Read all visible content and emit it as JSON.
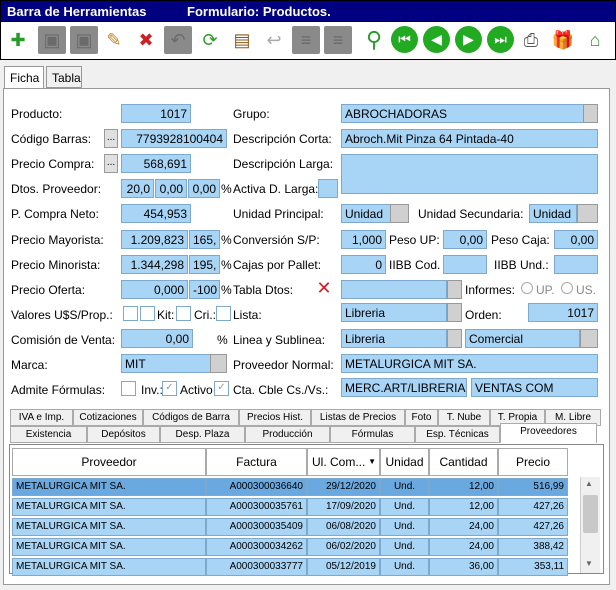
{
  "window": {
    "app": "Barra de Herramientas",
    "form": "Formulario: Productos."
  },
  "toolbar": {
    "icons": [
      "add-icon",
      "save-icon",
      "save-as-icon",
      "edit-icon",
      "delete-save-icon",
      "undo-icon",
      "refresh-icon",
      "film-icon",
      "back-arrow-icon",
      "list-icon",
      "list2-icon",
      "search-icon",
      "first-record-icon",
      "prev-record-icon",
      "next-record-icon",
      "last-record-icon",
      "print-icon",
      "gift-icon",
      "home-icon"
    ]
  },
  "tabs": [
    {
      "label": "Ficha"
    },
    {
      "label": "Tabla"
    }
  ],
  "form": {
    "producto_label": "Producto:",
    "producto": "1017",
    "grupo_label": "Grupo:",
    "grupo": "ABROCHADORAS",
    "codigo_barras_label": "Código Barras:",
    "codigo_barras": "7793928100404",
    "desc_corta_label": "Descripción Corta:",
    "desc_corta": "Abroch.Mit Pinza 64 Pintada-40",
    "precio_compra_label": "Precio Compra:",
    "precio_compra": "568,691",
    "desc_larga_label": "Descripción Larga:",
    "dtos_label": "Dtos. Proveedor:",
    "dto1": "20,0",
    "dto2": "0,00",
    "dto3": "0,00",
    "pct": "%",
    "activa_label": "Activa D. Larga:",
    "pcompra_neto_label": "P. Compra Neto:",
    "pcompra_neto": "454,953",
    "unidad_principal_label": "Unidad Principal:",
    "unidad_principal": "Unidad",
    "unidad_secundaria_label": "Unidad Secundaria:",
    "unidad_secundaria": "Unidad",
    "precio_mayorista_label": "Precio Mayorista:",
    "precio_mayorista": "1.209,823",
    "pct_mayorista": "165,",
    "conversion_label": "Conversión S/P:",
    "conversion": "1,000",
    "peso_up_label": "Peso UP:",
    "peso_up": "0,00",
    "peso_caja_label": "Peso Caja:",
    "peso_caja": "0,00",
    "precio_minorista_label": "Precio Minorista:",
    "precio_minorista": "1.344,298",
    "pct_minorista": "195,",
    "cajas_label": "Cajas por Pallet:",
    "cajas": "0",
    "iibb_cod_label": "IIBB Cod.",
    "iibb_und_label": "IIBB Und.:",
    "precio_oferta_label": "Precio Oferta:",
    "precio_oferta": "0,000",
    "pct_oferta": "-100",
    "tabla_dtos_label": "Tabla Dtos:",
    "informes_label": "Informes:",
    "informes_up": "UP.",
    "informes_us": "US.",
    "valores_label": "Valores U$S/Prop.:",
    "kit_label": "Kit:",
    "cri_label": "Cri.:",
    "lista_label": "Lista:",
    "lista": "Libreria",
    "orden_label": "Orden:",
    "orden": "1017",
    "comision_label": "Comisión de Venta:",
    "comision": "0,00",
    "linea_label": "Linea y Sublinea:",
    "linea": "Libreria",
    "sublinea": "Comercial",
    "marca_label": "Marca:",
    "marca": "MIT",
    "proveedor_label": "Proveedor Normal:",
    "proveedor": "METALURGICA MIT SA.",
    "admite_label": "Admite Fórmulas:",
    "inv_label": "Inv.:",
    "activo_label": "Activo",
    "cta_label": "Cta. Cble Cs./Vs.:",
    "cta1": "MERC.ART/LIBRERIA",
    "cta2": "VENTAS COM"
  },
  "bottom_tabs_row1": [
    "IVA e Imp.",
    "Cotizaciones",
    "Códigos de Barra",
    "Precios Hist.",
    "Listas de Precios",
    "Foto",
    "T. Nube",
    "T. Propia",
    "M. Libre"
  ],
  "bottom_tabs_row2": [
    "Existencia",
    "Depósitos",
    "Desp. Plaza",
    "Producción",
    "Fórmulas",
    "Esp. Técnicas",
    "Proveedores"
  ],
  "grid": {
    "headers": [
      "Proveedor",
      "Factura",
      "Ul. Com...",
      "Unidad",
      "Cantidad",
      "Precio"
    ],
    "rows": [
      [
        "METALURGICA MIT SA.",
        "A000300036640",
        "29/12/2020",
        "Und.",
        "12,00",
        "516,99"
      ],
      [
        "METALURGICA MIT SA.",
        "A000300035761",
        "17/09/2020",
        "Und.",
        "12,00",
        "427,26"
      ],
      [
        "METALURGICA MIT SA.",
        "A000300035409",
        "06/08/2020",
        "Und.",
        "24,00",
        "427,26"
      ],
      [
        "METALURGICA MIT SA.",
        "A000300034262",
        "06/02/2020",
        "Und.",
        "24,00",
        "388,42"
      ],
      [
        "METALURGICA MIT SA.",
        "A000300033777",
        "05/12/2019",
        "Und.",
        "36,00",
        "353,11"
      ]
    ]
  }
}
